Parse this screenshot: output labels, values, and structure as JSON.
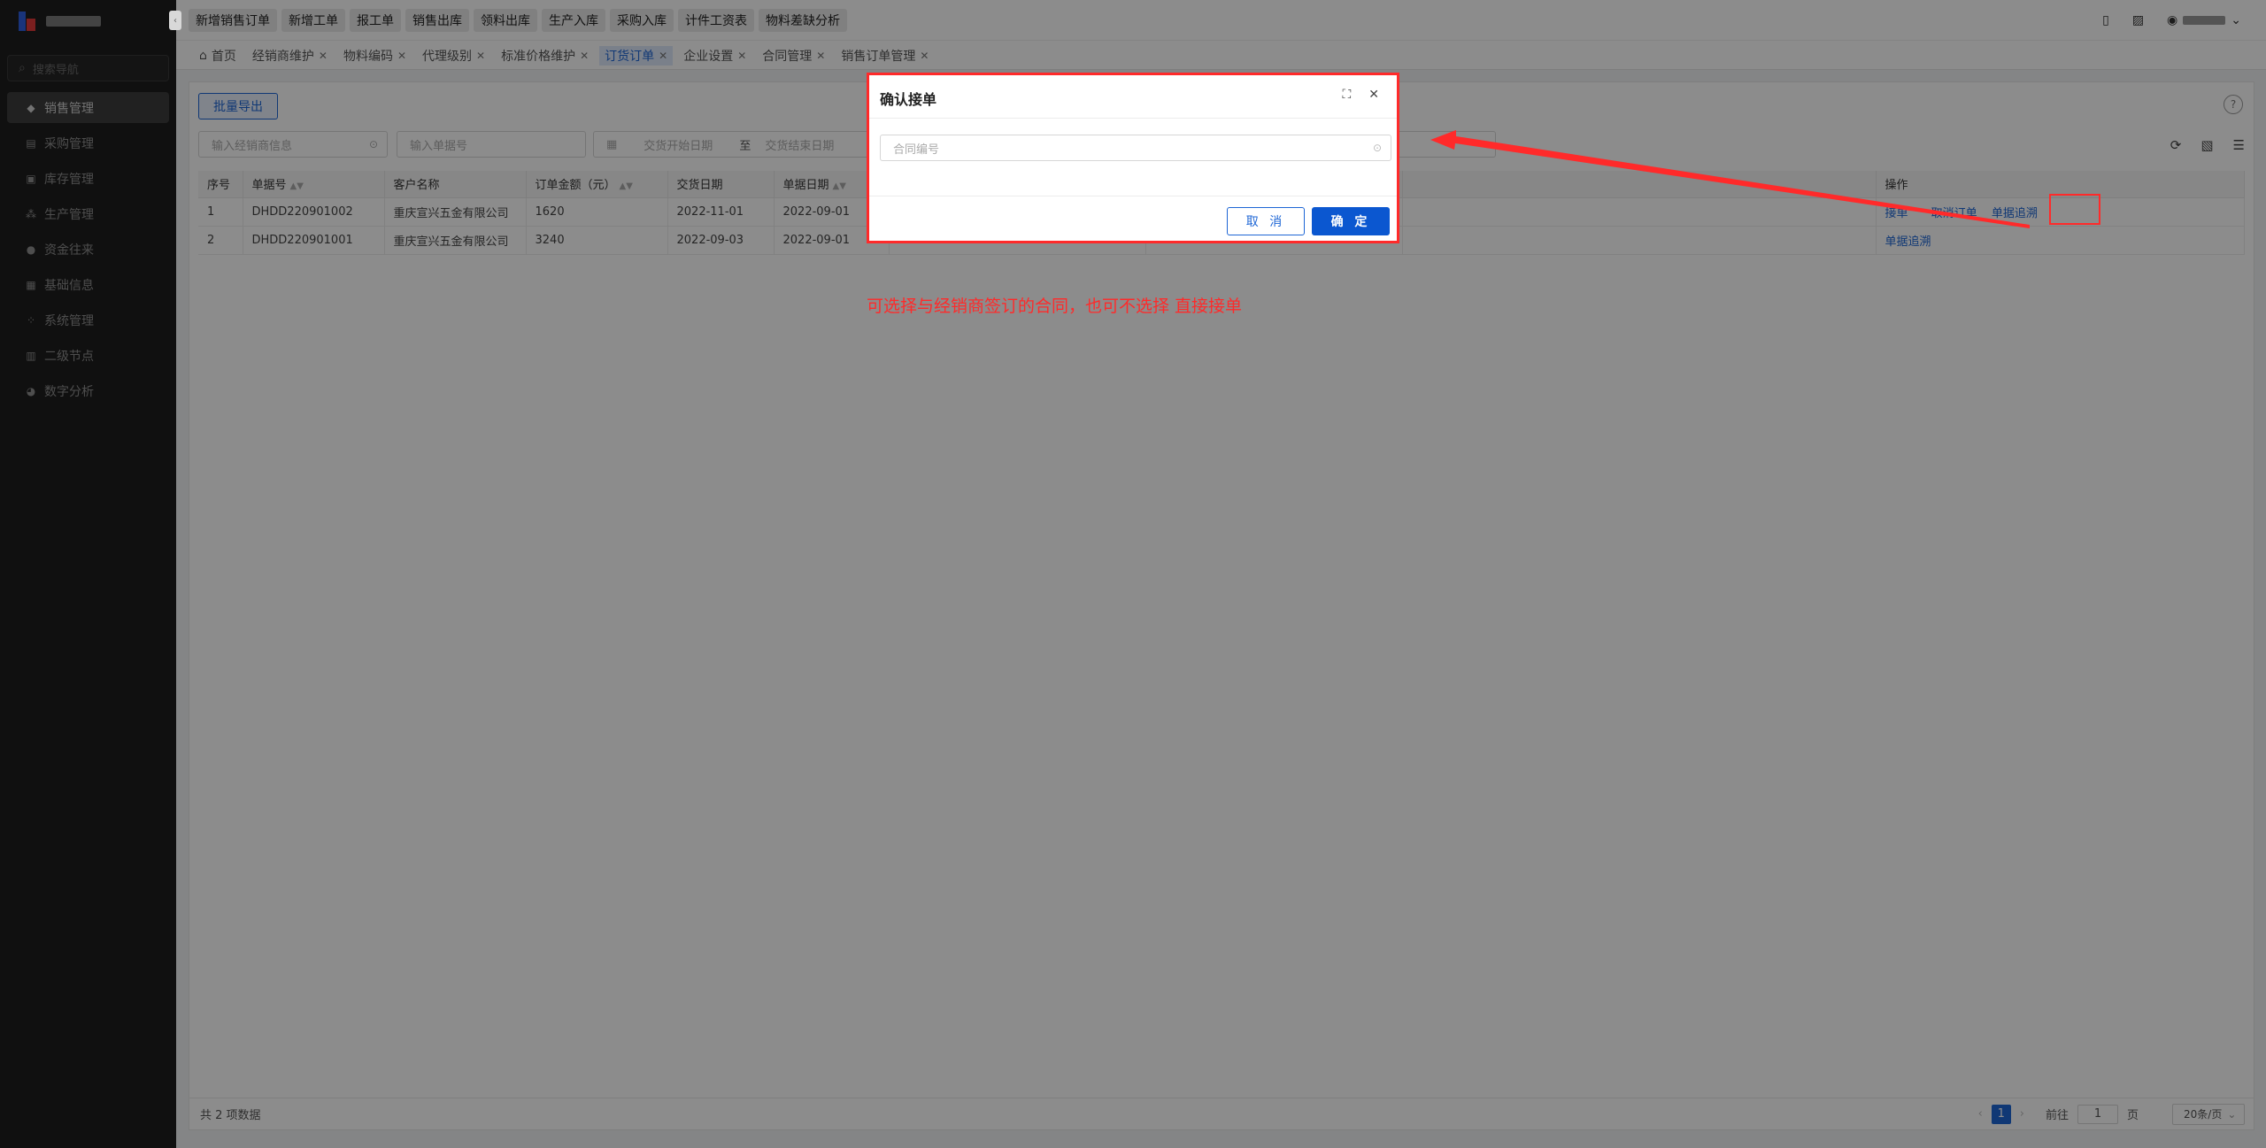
{
  "sidebar": {
    "search_placeholder": "搜索导航",
    "items": [
      {
        "label": "销售管理",
        "icon": "tag-icon",
        "active": true
      },
      {
        "label": "采购管理",
        "icon": "cart-icon"
      },
      {
        "label": "库存管理",
        "icon": "box-icon"
      },
      {
        "label": "生产管理",
        "icon": "share-icon"
      },
      {
        "label": "资金往来",
        "icon": "money-icon"
      },
      {
        "label": "基础信息",
        "icon": "grid-icon"
      },
      {
        "label": "系统管理",
        "icon": "apps-icon"
      },
      {
        "label": "二级节点",
        "icon": "doc-icon"
      },
      {
        "label": "数字分析",
        "icon": "pie-icon"
      }
    ]
  },
  "quick_actions": [
    "新增销售订单",
    "新增工单",
    "报工单",
    "销售出库",
    "领料出库",
    "生产入库",
    "采购入库",
    "计件工资表",
    "物料差缺分析"
  ],
  "tabs": [
    {
      "label": "首页",
      "home": true
    },
    {
      "label": "经销商维护"
    },
    {
      "label": "物料编码"
    },
    {
      "label": "代理级别"
    },
    {
      "label": "标准价格维护"
    },
    {
      "label": "订货订单",
      "active": true
    },
    {
      "label": "企业设置"
    },
    {
      "label": "合同管理"
    },
    {
      "label": "销售订单管理"
    }
  ],
  "toolbar": {
    "export_label": "批量导出",
    "help": "?"
  },
  "filters": {
    "dealer_placeholder": "输入经销商信息",
    "order_no_placeholder": "输入单据号",
    "date_start_placeholder": "交货开始日期",
    "date_end_placeholder": "交货结束日期",
    "range_sep": "至"
  },
  "table": {
    "columns": [
      "序号",
      "单据号",
      "客户名称",
      "订单金额（元）",
      "交货日期",
      "单据日期",
      "操作"
    ],
    "rows": [
      {
        "no": "1",
        "order_no": "DHDD220901002",
        "customer": "重庆宣兴五金有限公司",
        "amount": "1620",
        "delivery": "2022-11-01",
        "date": "2022-09-01",
        "ops": [
          "接单",
          "取消订单",
          "单据追溯"
        ]
      },
      {
        "no": "2",
        "order_no": "DHDD220901001",
        "customer": "重庆宣兴五金有限公司",
        "amount": "3240",
        "delivery": "2022-09-03",
        "date": "2022-09-01",
        "ops": [
          "单据追溯"
        ]
      }
    ]
  },
  "footer": {
    "total_text": "共 2 项数据",
    "page": "1",
    "goto_label": "前往",
    "goto_value": "1",
    "page_unit": "页",
    "page_size": "20条/页"
  },
  "modal": {
    "title": "确认接单",
    "contract_placeholder": "合同编号",
    "cancel_label": "取 消",
    "ok_label": "确 定"
  },
  "annotation": {
    "note": "可选择与经销商签订的合同，也可不选择 直接接单",
    "color": "#ff2a2a"
  },
  "colors": {
    "primary": "#1e66d5",
    "sidebar_bg": "#1e1e1e"
  }
}
